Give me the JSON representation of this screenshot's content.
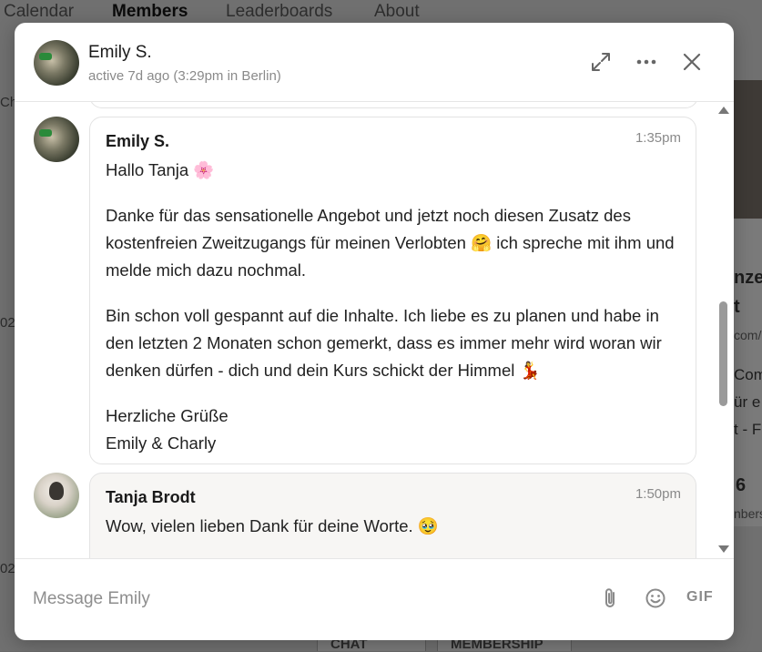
{
  "background": {
    "nav": [
      "Calendar",
      "Members",
      "Leaderboards",
      "About"
    ],
    "bottom_tabs": [
      "CHAT",
      "MEMBERSHIP"
    ],
    "fragments": {
      "right": [
        "nzer",
        "t",
        "com/",
        "Com",
        "ür e",
        "t - F",
        "6",
        "nbers"
      ],
      "left": [
        "Ch",
        "02",
        "02"
      ]
    }
  },
  "modal": {
    "contact": {
      "name": "Emily S.",
      "status": "active 7d ago (3:29pm in Berlin)"
    },
    "header_icons": [
      "expand-icon",
      "more-icon",
      "close-icon"
    ],
    "messages": [
      {
        "sender": "Emily S.",
        "time": "1:35pm",
        "paragraphs": [
          "Hallo Tanja 🌸",
          "Danke für das sensationelle Angebot und jetzt noch diesen Zusatz des kostenfreien Zweitzugangs für meinen Verlobten 🤗 ich spreche mit ihm und melde mich dazu nochmal.",
          "Bin schon voll gespannt auf die Inhalte. Ich liebe es zu planen und habe in den letzten 2 Monaten schon gemerkt, dass es immer mehr wird woran wir denken dürfen - dich und dein Kurs schickt der Himmel 💃",
          "Herzliche Grüße",
          "Emily & Charly"
        ]
      },
      {
        "sender": "Tanja Brodt",
        "time": "1:50pm",
        "paragraphs": [
          "Wow, vielen lieben Dank für deine Worte. 🥹"
        ]
      }
    ],
    "composer": {
      "placeholder": "Message Emily",
      "gif_label": "GIF"
    }
  }
}
